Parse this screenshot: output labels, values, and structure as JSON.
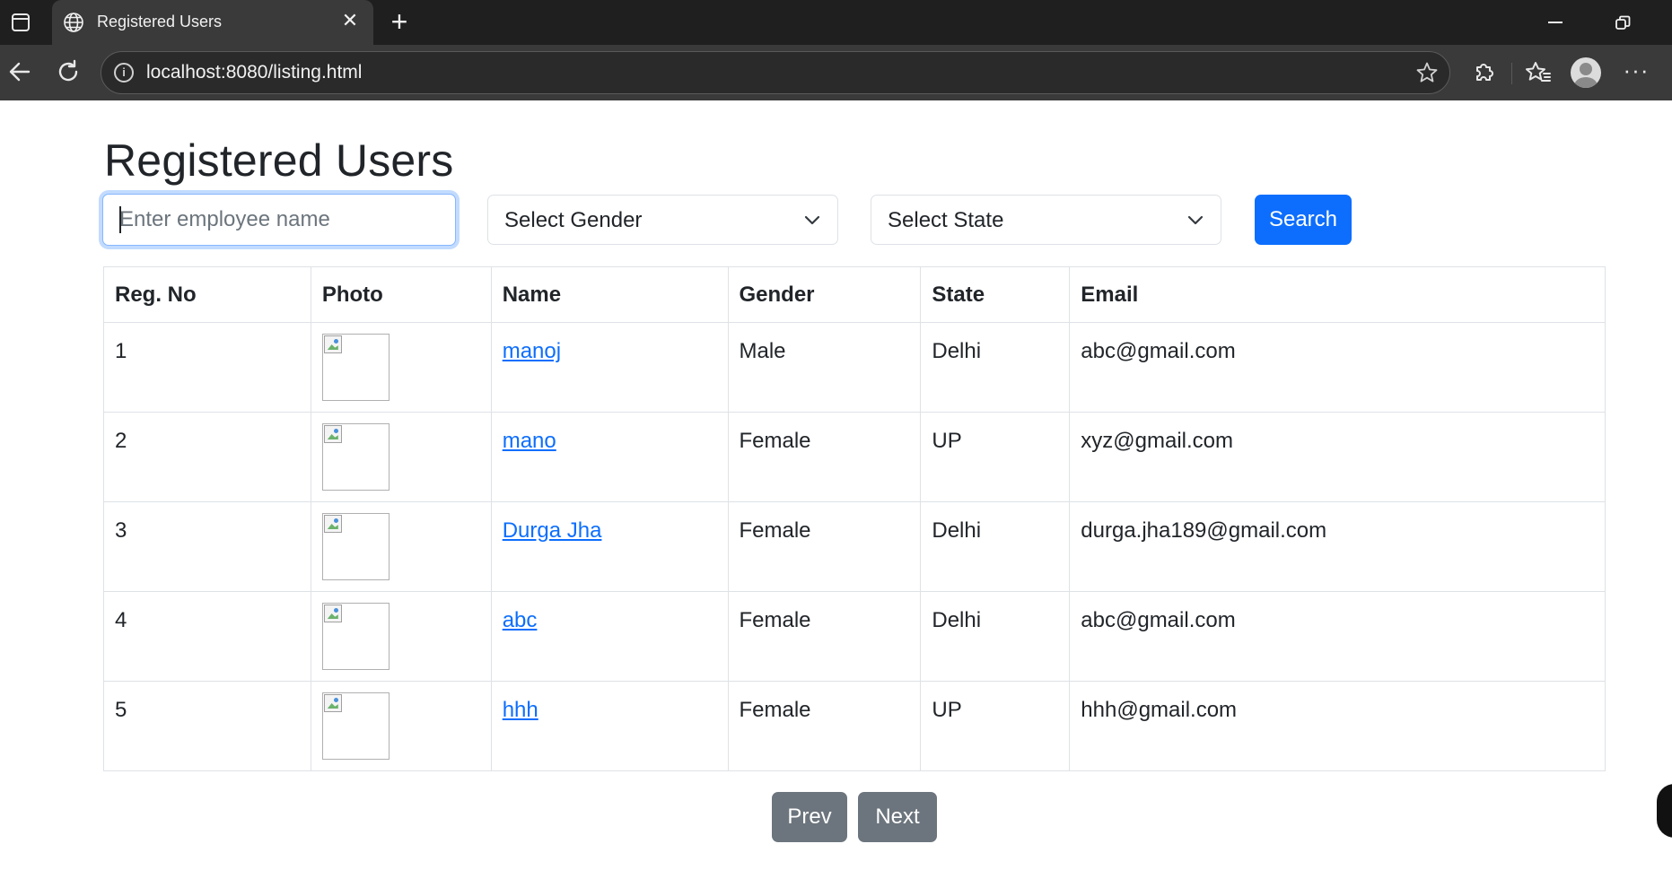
{
  "browser": {
    "tab_title": "Registered Users",
    "url": "localhost:8080/listing.html"
  },
  "page": {
    "title": "Registered Users",
    "search_placeholder": "Enter employee name",
    "gender_select": "Select Gender",
    "state_select": "Select State",
    "search_button": "Search"
  },
  "table": {
    "headers": [
      "Reg. No",
      "Photo",
      "Name",
      "Gender",
      "State",
      "Email"
    ],
    "rows": [
      {
        "reg": "1",
        "name": "manoj",
        "gender": "Male",
        "state": "Delhi",
        "email": "abc@gmail.com"
      },
      {
        "reg": "2",
        "name": "mano",
        "gender": "Female",
        "state": "UP",
        "email": "xyz@gmail.com"
      },
      {
        "reg": "3",
        "name": "Durga Jha",
        "gender": "Female",
        "state": "Delhi",
        "email": "durga.jha189@gmail.com"
      },
      {
        "reg": "4",
        "name": "abc",
        "gender": "Female",
        "state": "Delhi",
        "email": "abc@gmail.com"
      },
      {
        "reg": "5",
        "name": "hhh",
        "gender": "Female",
        "state": "UP",
        "email": "hhh@gmail.com"
      }
    ]
  },
  "pagination": {
    "prev": "Prev",
    "next": "Next"
  },
  "colors": {
    "primary": "#0d6efd",
    "secondary": "#6c757d",
    "chrome_dark": "#1f1f1f",
    "chrome_toolbar": "#3a3a3a"
  },
  "icons": [
    "tab-actions-icon",
    "globe-icon",
    "close-icon",
    "plus-icon",
    "minimize-icon",
    "restore-icon",
    "back-arrow-icon",
    "refresh-icon",
    "info-icon",
    "star-icon",
    "extensions-icon",
    "favorites-icon",
    "profile-icon",
    "more-icon",
    "chevron-down-icon",
    "broken-image-icon"
  ]
}
